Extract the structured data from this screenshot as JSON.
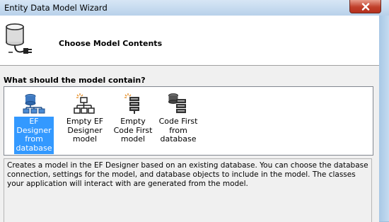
{
  "window": {
    "title": "Entity Data Model Wizard",
    "close_icon": "close-icon"
  },
  "header": {
    "title": "Choose Model Contents",
    "icon": "database-plug-icon"
  },
  "main": {
    "question": "What should the model contain?",
    "options": [
      {
        "label": "EF Designer from database",
        "icon": "database-tree-icon",
        "selected": true
      },
      {
        "label": "Empty EF Designer model",
        "icon": "empty-designer-icon",
        "selected": false
      },
      {
        "label": "Empty Code First model",
        "icon": "empty-code-first-icon",
        "selected": false
      },
      {
        "label": "Code First from database",
        "icon": "code-first-database-icon",
        "selected": false
      }
    ],
    "description": "Creates a model in the EF Designer based on an existing database. You can choose the database connection, settings for the model, and database objects to include in the model. The classes your application will interact with are generated from the model."
  },
  "colors": {
    "selection": "#3399ff",
    "close_button": "#c1402b"
  }
}
